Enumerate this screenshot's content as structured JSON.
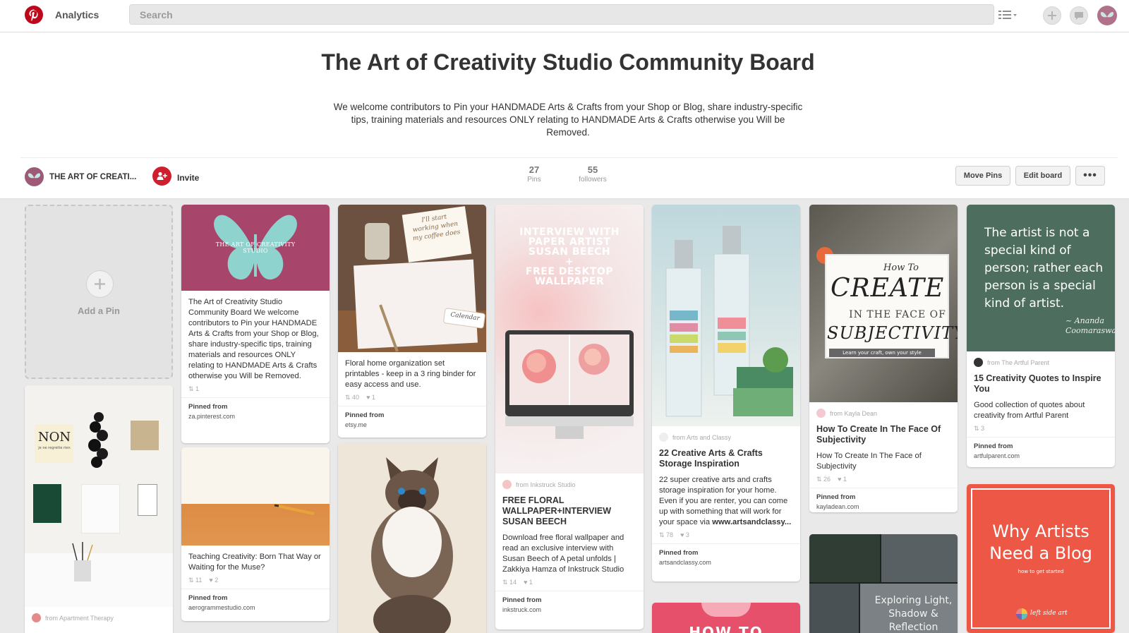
{
  "nav": {
    "analytics": "Analytics",
    "search_placeholder": "Search"
  },
  "board": {
    "title": "The Art of Creativity Studio Community Board",
    "description": "We welcome contributors to Pin your HANDMADE Arts & Crafts from your Shop or Blog, share industry-specific tips, training materials and resources ONLY relating to HANDMADE Arts & Crafts otherwise you Will be Removed.",
    "owner_name": "THE ART OF CREATI...",
    "invite_label": "Invite",
    "stats": [
      {
        "value": "27",
        "label": "Pins"
      },
      {
        "value": "55",
        "label": "followers"
      }
    ],
    "buttons": {
      "move_pins": "Move Pins",
      "edit_board": "Edit board",
      "more": "•••"
    }
  },
  "add_pin": {
    "label": "Add a Pin"
  },
  "pins": {
    "p1": {
      "logo_text": "THE ART OF CREATIVITY STUDIO",
      "description": "The Art of Creativity Studio Community Board We welcome contributors to Pin your HANDMADE Arts & Crafts from your Shop or Blog, share industry-specific tips, training materials and resources ONLY relating to HANDMADE Arts & Crafts otherwise you Will be Removed.",
      "repins": "1",
      "pinned_from_label": "Pinned from",
      "domain": "za.pinterest.com"
    },
    "p2": {
      "description": "Floral home organization set printables - keep in a 3 ring binder for easy access and use.",
      "repins": "40",
      "likes": "1",
      "pinned_from_label": "Pinned from",
      "domain": "etsy.me",
      "image_notes": [
        "I'll start working when my coffee does",
        "Calendar"
      ]
    },
    "p3": {
      "overlay": [
        "INTERVIEW WITH",
        "PAPER ARTIST",
        "SUSAN BEECH",
        "+",
        "FREE DESKTOP",
        "WALLPAPER"
      ],
      "source": "from Inkstruck Studio",
      "title": "FREE FLORAL WALLPAPER+INTERVIEW SUSAN BEECH",
      "description": "Download free floral wallpaper and read an exclusive interview with Susan Beech of A petal unfolds | Zakkiya Hamza of Inkstruck Studio",
      "repins": "14",
      "likes": "1",
      "pinned_from_label": "Pinned from",
      "domain": "inkstruck.com"
    },
    "p4": {
      "source": "from Arts and Classy",
      "title": "22 Creative Arts & Crafts Storage Inspiration",
      "description": "22 super creative arts and crafts storage inspiration for your home. Even if you are renter, you can come up with something that will work for your space via",
      "link": "www.artsandclassy...",
      "repins": "78",
      "likes": "3",
      "pinned_from_label": "Pinned from",
      "domain": "artsandclassy.com"
    },
    "p5": {
      "image_lines": [
        "How To",
        "CREATE",
        "IN THE FACE OF",
        "SUBJECTIVITY",
        "Learn your craft, own your style"
      ],
      "source": "from Kayla Dean",
      "title": "How To Create In The Face Of Subjectivity",
      "description": "How To Create In The Face of Subjectivity",
      "repins": "26",
      "likes": "1",
      "pinned_from_label": "Pinned from",
      "domain": "kayladean.com"
    },
    "p6": {
      "quote": "The artist is not a special kind of person; rather each person is a special kind of artist.",
      "author": "~ Ananda Coomaraswamy",
      "source": "from The Artful Parent",
      "title": "15 Creativity Quotes to Inspire You",
      "description": "Good collection of quotes about creativity from Artful Parent",
      "repins": "3",
      "pinned_from_label": "Pinned from",
      "domain": "artfulparent.com"
    },
    "p7": {
      "image_word": "NON",
      "image_sub": "je ne regrette rien",
      "source": "from Apartment Therapy"
    },
    "p8": {
      "description": "Teaching Creativity: Born That Way or Waiting for the Muse?",
      "repins": "11",
      "likes": "2",
      "pinned_from_label": "Pinned from",
      "domain": "aerogrammestudio.com"
    },
    "p10": {
      "title": "HOW TO"
    },
    "p11": {
      "lines": [
        "Exploring Light,",
        "Shadow & Reflection"
      ]
    },
    "p12": {
      "lines": [
        "Why Artists",
        "Need a Blog"
      ],
      "subtitle": "how to get started",
      "brand": "left side art"
    }
  },
  "colors": {
    "brand_red": "#bd081c",
    "board_logo_bg": "#a7456a",
    "butterfly": "#8fd3cf",
    "quote_bg": "#4d6e5f",
    "blog_bg": "#ec5845"
  }
}
